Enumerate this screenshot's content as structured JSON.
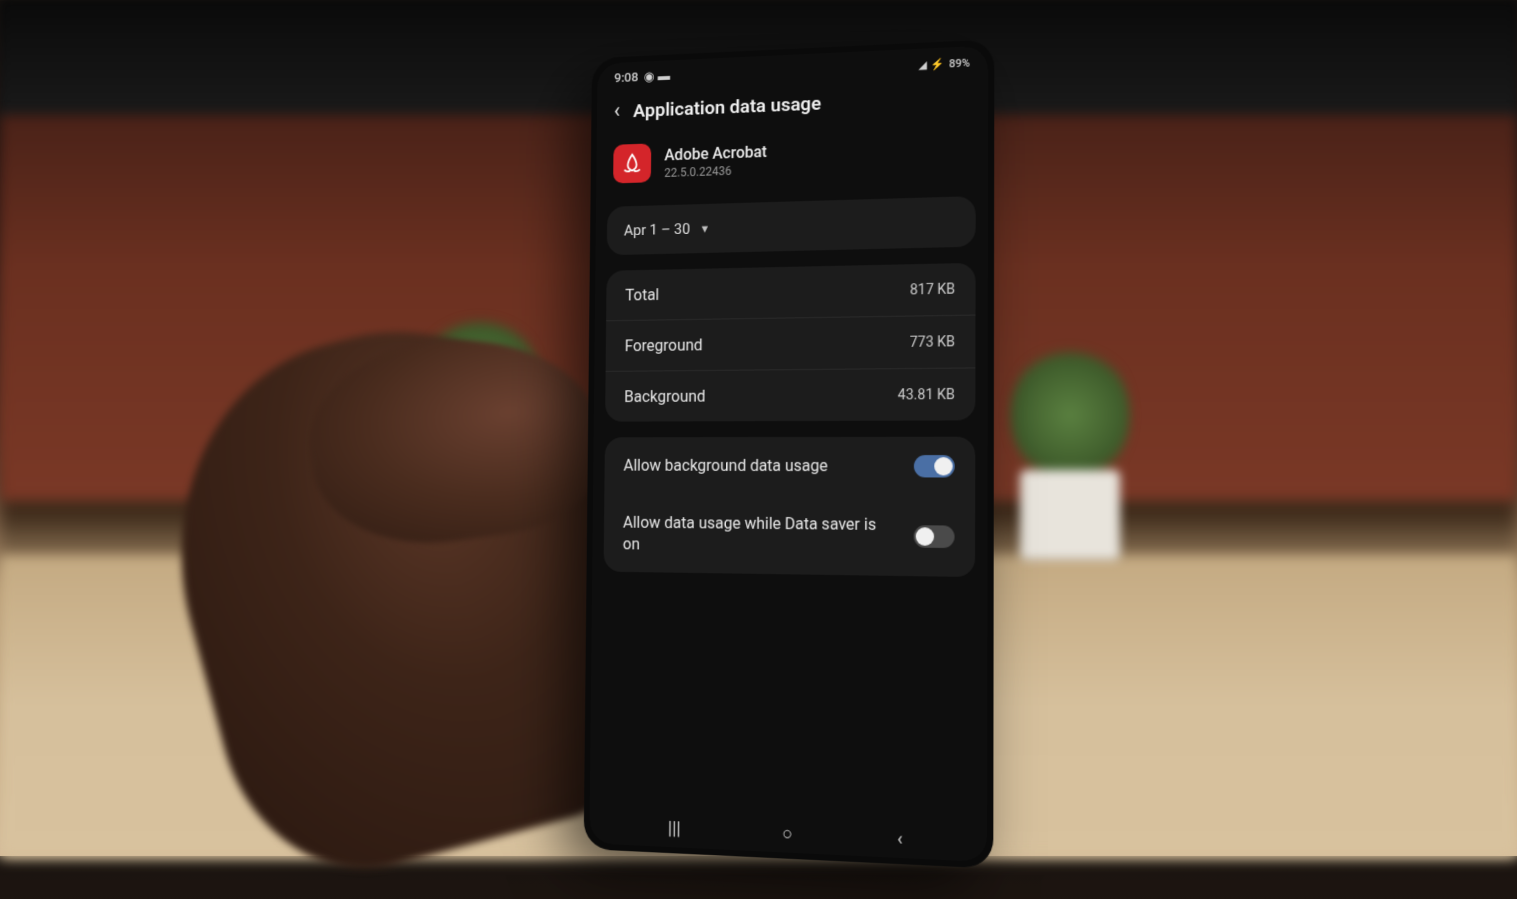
{
  "status_bar": {
    "time": "9:08",
    "battery": "89%"
  },
  "header": {
    "title": "Application data usage"
  },
  "app": {
    "name": "Adobe Acrobat",
    "version": "22.5.0.22436"
  },
  "date_range": {
    "label": "Apr 1 – 30"
  },
  "usage": [
    {
      "label": "Total",
      "value": "817 KB"
    },
    {
      "label": "Foreground",
      "value": "773 KB"
    },
    {
      "label": "Background",
      "value": "43.81 KB"
    }
  ],
  "toggles": [
    {
      "label": "Allow background data usage",
      "enabled": true
    },
    {
      "label": "Allow data usage while Data saver is on",
      "enabled": false
    }
  ]
}
